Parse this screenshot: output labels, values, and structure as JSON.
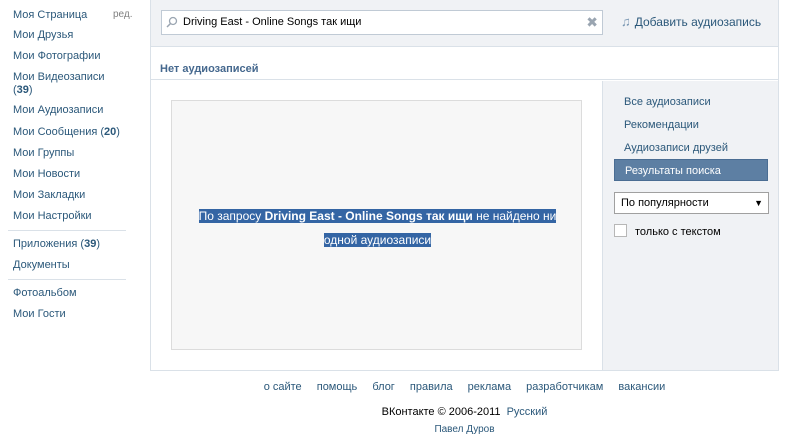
{
  "leftnav": {
    "edit_label": "ред.",
    "items": [
      {
        "label": "Моя Страница"
      },
      {
        "label": "Мои Друзья"
      },
      {
        "label": "Мои Фотографии"
      },
      {
        "label": "Мои Видеозаписи",
        "label2_pre": "(",
        "count": "39",
        "label2_post": ")"
      },
      {
        "label": "Мои Аудиозаписи"
      },
      {
        "label": "Мои Сообщения",
        "count": "20"
      },
      {
        "label": "Мои Группы"
      },
      {
        "label": "Мои Новости"
      },
      {
        "label": "Мои Закладки"
      },
      {
        "label": "Мои Настройки"
      },
      {
        "label": "Приложения",
        "count": "39"
      },
      {
        "label": "Документы"
      },
      {
        "label": "Фотоальбом"
      },
      {
        "label": "Мои Гости"
      }
    ]
  },
  "search": {
    "value": "Driving East - Online Songs так ищи",
    "clear_icon": "close-icon"
  },
  "add_audio_label": "Добавить аудиозапись",
  "page_title": "Нет аудиозаписей",
  "empty_message": {
    "pre": "По запросу ",
    "query": "Driving East - Online Songs так ищи",
    "post1": " не найдено ни",
    "line2": "одной аудиозаписи"
  },
  "sidebar": {
    "items": [
      {
        "label": "Все аудиозаписи"
      },
      {
        "label": "Рекомендации"
      },
      {
        "label": "Аудиозаписи друзей"
      },
      {
        "label": "Результаты поиска",
        "active": true
      }
    ],
    "sort_selected": "По популярности",
    "only_text_label": "только с текстом"
  },
  "footer": {
    "links": [
      "о сайте",
      "помощь",
      "блог",
      "правила",
      "реклама",
      "разработчикам",
      "вакансии"
    ],
    "copyright": "ВКонтакте © 2006-2011",
    "language": "Русский",
    "author": "Павел Дуров"
  },
  "colors": {
    "link": "#2b587a",
    "accent": "#5d7fa3",
    "selection": "#3465a4"
  }
}
